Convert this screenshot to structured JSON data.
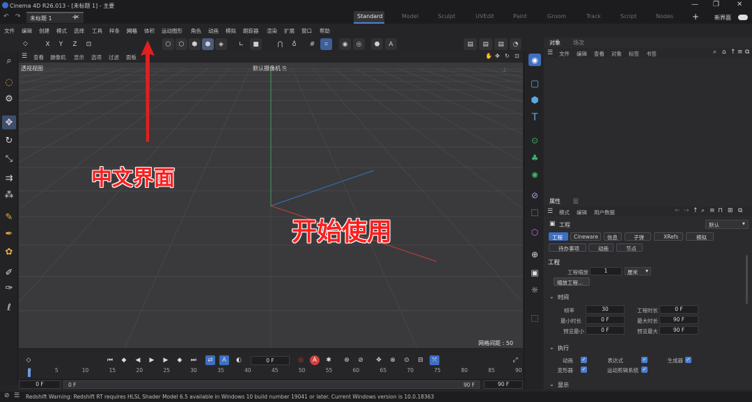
{
  "window": {
    "title": "Cinema 4D R26.013 - [未标题 1] - 主要"
  },
  "doc_tab": {
    "label": "未标题 1"
  },
  "layouts": [
    "Standard",
    "Model",
    "Sculpt",
    "UVEdit",
    "Paint",
    "Groom",
    "Track",
    "Script",
    "Nodes"
  ],
  "new_layout": "新界面",
  "menu": [
    "文件",
    "编辑",
    "创建",
    "模式",
    "选择",
    "工具",
    "样条",
    "网格",
    "体积",
    "运动图形",
    "角色",
    "动画",
    "模拟",
    "跟踪器",
    "渲染",
    "扩展",
    "窗口",
    "帮助"
  ],
  "axis_buttons": [
    "X",
    "Y",
    "Z"
  ],
  "viewport": {
    "menu": [
      "查看",
      "摄像机",
      "显示",
      "选项",
      "过滤",
      "面板"
    ],
    "view_label": "透视视图",
    "camera_label": "默认摄像机",
    "grid_spacing": "网格间距 : 50 cm",
    "move_tooltip": "移动"
  },
  "annotations": {
    "chinese_ui": "中文界面",
    "start_using": "开始使用"
  },
  "object_panel": {
    "tabs": [
      "对象",
      "场次"
    ],
    "menu": [
      "文件",
      "编辑",
      "查看",
      "对象",
      "标签",
      "书签"
    ]
  },
  "attr_panel": {
    "tabs": [
      "属性",
      "层"
    ],
    "menu": [
      "模式",
      "编辑",
      "用户数据"
    ],
    "object_name": "工程",
    "preset": "默认",
    "chips_row1": [
      "工程",
      "Cineware",
      "信息",
      "子弹",
      "XRefs",
      "模拟"
    ],
    "chips_row2": [
      "待办事项",
      "动画",
      "节点"
    ],
    "section_title": "工程",
    "scale_label": "工程缩放",
    "scale_value": "1",
    "scale_unit": "厘米",
    "scale_button": "缩放工程...",
    "time_section": "时间",
    "fps_label": "帧率",
    "fps_value": "30",
    "duration_label": "工程时长",
    "duration_value": "0 F",
    "min_label": "最小时长",
    "min_value": "0 F",
    "max_label": "最大时长",
    "max_value": "90 F",
    "pmin_label": "预览最小",
    "pmin_value": "0 F",
    "pmax_label": "预览最大",
    "pmax_value": "90 F",
    "exec_section": "执行",
    "anim_label": "动画",
    "expr_label": "表达式",
    "gen_label": "生成器",
    "deform_label": "变形器",
    "motion_label": "运动剪辑系统",
    "display_section": "显示"
  },
  "timeline": {
    "current_frame": "0 F",
    "ruler": [
      "0",
      "5",
      "10",
      "15",
      "20",
      "25",
      "30",
      "35",
      "40",
      "45",
      "50",
      "55",
      "60",
      "65",
      "70",
      "75",
      "80",
      "85",
      "90"
    ],
    "start": "0 F",
    "range_start": "0 F",
    "range_end": "90 F",
    "end": "90 F"
  },
  "status": {
    "message": "Redshift Warning: Redshift RT requires HLSL Shader Model 6.5 available in Windows 10 build number 19041 or later. Current Windows version is 10.0.18363"
  },
  "colors": {
    "accent": "#4a83d6",
    "annotation_red": "#ff1e1e",
    "axis_x": "#c4403a",
    "axis_y": "#3fa05a",
    "axis_z": "#3a73c4"
  }
}
